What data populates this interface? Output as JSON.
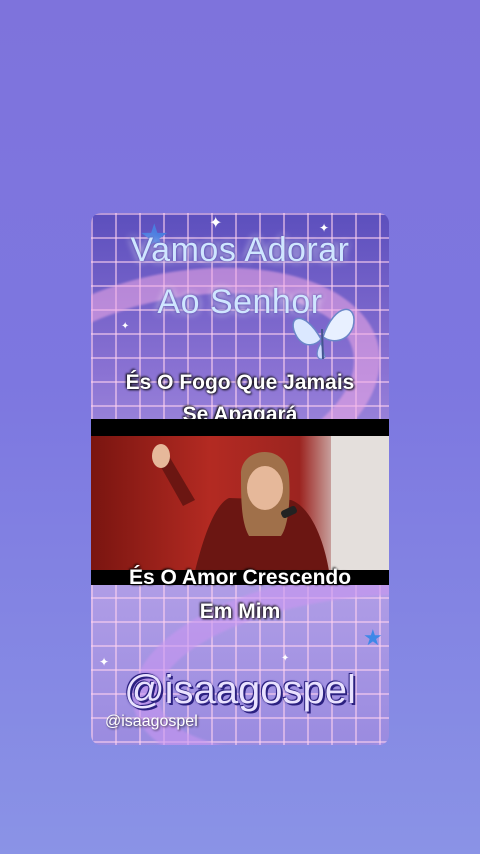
{
  "card": {
    "title_line1": "Vamos Adorar",
    "title_line2": "Ao Senhor",
    "lyric1_line1": "És O Fogo Que Jamais",
    "lyric1_line2": "Se Apagará",
    "lyric2_line1": "És O Amor Crescendo",
    "lyric2_line2": "Em Mim",
    "handle_large": "@isaagospel",
    "handle_small": "@isaagospel"
  },
  "icons": {
    "butterfly": "butterfly-icon",
    "star": "star-icon",
    "sparkle": "sparkle-icon"
  },
  "colors": {
    "background_top": "#7e73dc",
    "background_bottom": "#8a93e6",
    "title_text": "#cfe6ff",
    "lyric_text": "#ffffff"
  }
}
